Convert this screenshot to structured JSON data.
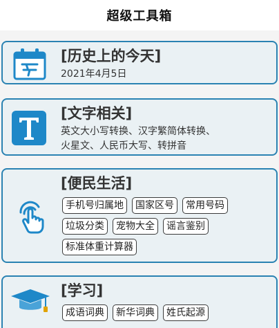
{
  "header": {
    "title": "超级工具箱"
  },
  "cards": [
    {
      "icon": "calendar-icon",
      "title": "[历史上的今天]",
      "subtitle": "2021年4月5日"
    },
    {
      "icon": "text-t-icon",
      "title": "[文字相关]",
      "lines": [
        "英文大小写转换、汉字繁简体转换、",
        "火星文、人民币大写、转拼音"
      ]
    },
    {
      "icon": "tap-hand-icon",
      "title": "[便民生活]",
      "tags": [
        "手机号归属地",
        "国家区号",
        "常用号码",
        "垃圾分类",
        "宠物大全",
        "谣言鉴别",
        "标准体重计算器"
      ]
    },
    {
      "icon": "graduation-cap-icon",
      "title": "[学习]",
      "tags": [
        "成语词典",
        "新华词典",
        "姓氏起源"
      ]
    }
  ],
  "colors": {
    "accent": "#2a82b2",
    "icon_blue": "#1e88c8",
    "card_bg": "#eaf1f4"
  }
}
